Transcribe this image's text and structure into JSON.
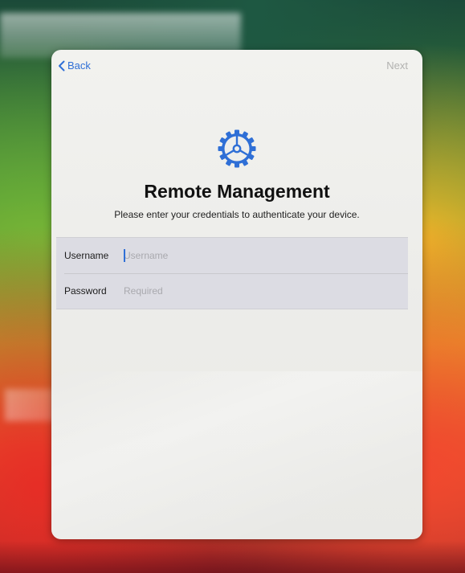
{
  "nav": {
    "back_label": "Back",
    "next_label": "Next"
  },
  "header": {
    "icon": "gear-icon",
    "title": "Remote Management",
    "subtitle": "Please enter your credentials to authenticate your device."
  },
  "form": {
    "username": {
      "label": "Username",
      "value": "",
      "placeholder": "Username"
    },
    "password": {
      "label": "Password",
      "value": "",
      "placeholder": "Required"
    }
  },
  "colors": {
    "accent": "#2f6fd6",
    "disabled": "#b2b2b0",
    "screen_bg": "#efefec",
    "form_bg": "#dcdce3"
  }
}
